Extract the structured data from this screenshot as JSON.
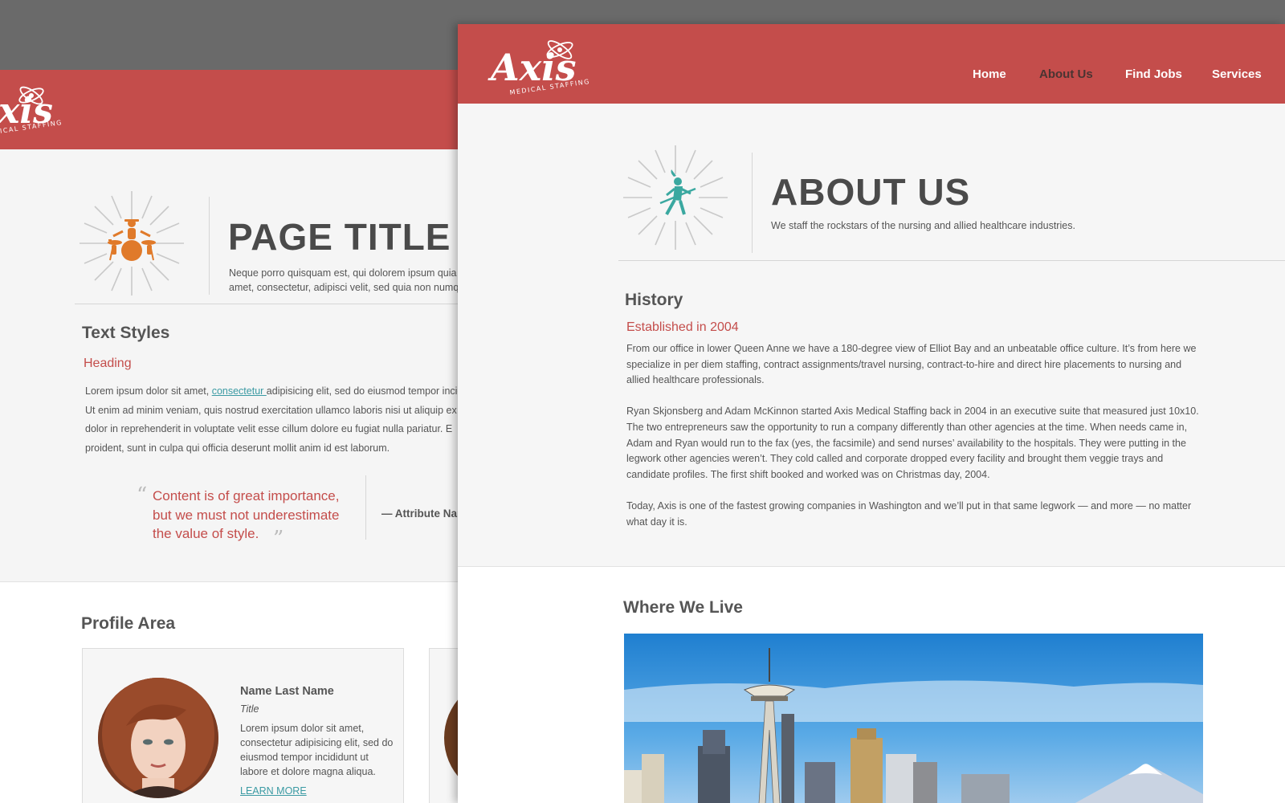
{
  "back_page": {
    "logo": {
      "wordmark": "Axis",
      "tagline": "MEDICAL STAFFING"
    },
    "page_title": "PAGE TITLE",
    "page_desc_line1": "Neque porro quisquam est, qui dolorem ipsum quia dolor sit",
    "page_desc_line2": "amet, consectetur, adipisci velit, sed quia non numquam",
    "text_styles_heading": "Text Styles",
    "sub_heading": "Heading",
    "para_before_link": "Lorem ipsum dolor sit amet, ",
    "para_link": "consectetur ",
    "para_after_link": "adipisicing elit, sed do eiusmod tempor incididunt ut labore",
    "para_line2": "Ut enim ad minim veniam, quis nostrud exercitation ullamco laboris nisi ut aliquip ex",
    "para_line3": "dolor in reprehenderit in voluptate velit esse cillum dolore eu fugiat nulla pariatur. E",
    "para_line4": "proident, sunt in culpa qui officia deserunt mollit anim id est laborum.",
    "quote": "Content is of great importance, but we must not underestimate the value of style.",
    "quote_attribution": "— Attribute Name",
    "profile_heading": "Profile Area",
    "profile": {
      "name": "Name Last Name",
      "title": "Title",
      "bio": "Lorem ipsum dolor sit amet, consectetur adipisicing elit, sed do eiusmod tempor incididunt ut labore et dolore magna aliqua.",
      "link": "LEARN MORE"
    }
  },
  "front_page": {
    "logo": {
      "wordmark": "Axis",
      "tagline": "MEDICAL STAFFING"
    },
    "nav": [
      {
        "label": "Home",
        "active": false
      },
      {
        "label": "About Us",
        "active": true
      },
      {
        "label": "Find Jobs",
        "active": false
      },
      {
        "label": "Services",
        "active": false
      }
    ],
    "title": "ABOUT US",
    "subtitle": "We staff the rockstars of the nursing and allied healthcare industries.",
    "history_heading": "History",
    "established": "Established in 2004",
    "history_paragraphs": [
      "From our office in lower Queen Anne we have a 180-degree view of Elliot Bay and an unbeatable office culture. It’s from here we specialize in per diem staffing, contract assignments/travel nursing, contract-to-hire and direct hire placements to nursing and allied healthcare professionals.",
      "Ryan Skjonsberg and Adam McKinnon started Axis Medical Staffing back in 2004 in an executive suite that measured just 10x10. The two entrepreneurs saw the opportunity to run a company differently than other agencies at the time. When needs came in, Adam and Ryan would run to the fax (yes, the facsimile) and send nurses’ availability to the hospitals. They were putting in the legwork other agencies weren’t. They cold called and corporate dropped every facility and brought them veggie trays and candidate profiles. The first shift booked and worked was on Christmas day, 2004.",
      "Today, Axis is one of the fastest growing companies in Washington and we’ll put in that same legwork — and more — no matter what day it is."
    ],
    "where_heading": "Where We Live"
  },
  "colors": {
    "brand_red": "#c44d4b",
    "heading_gray": "#4a4a4a",
    "link_teal": "#3a9aa3",
    "icon_orange": "#e07a2a",
    "icon_teal": "#3aa8a0"
  }
}
